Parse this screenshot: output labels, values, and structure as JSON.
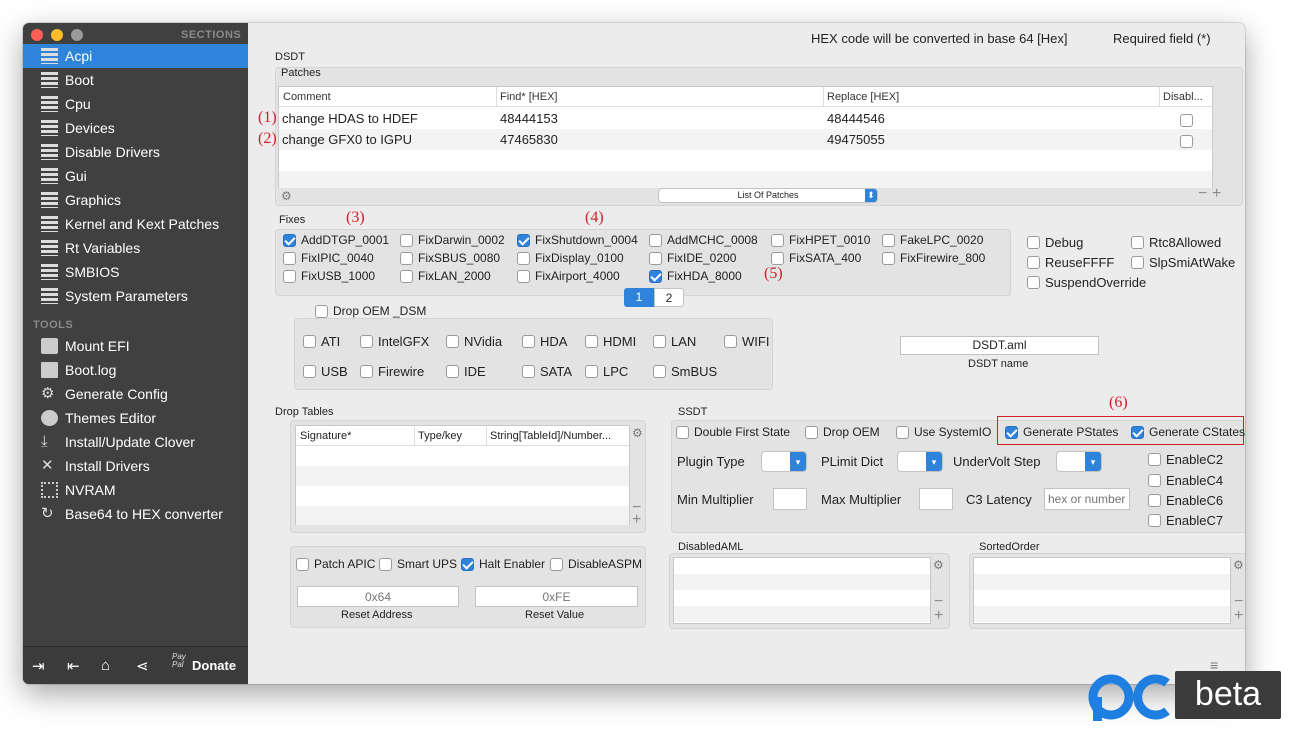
{
  "sidebar": {
    "sections_label": "SECTIONS",
    "tools_label": "TOOLS",
    "sections": [
      "Acpi",
      "Boot",
      "Cpu",
      "Devices",
      "Disable Drivers",
      "Gui",
      "Graphics",
      "Kernel and Kext Patches",
      "Rt Variables",
      "SMBIOS",
      "System Parameters"
    ],
    "tools": [
      "Mount EFI",
      "Boot.log",
      "Generate Config",
      "Themes Editor",
      "Install/Update Clover",
      "Install Drivers",
      "NVRAM",
      "Base64 to HEX converter"
    ],
    "tool_icons": [
      "disk-icon",
      "log-icon",
      "gear-icon",
      "palette-icon",
      "download-icon",
      "tools-icon",
      "chip-icon",
      "refresh-icon"
    ],
    "donate_label": "Donate",
    "paypal_label": "Pay Pal",
    "accent": "#2f83d9"
  },
  "header": {
    "hex_note": "HEX code will be converted in base 64 [Hex]",
    "required_note": "Required field (*)"
  },
  "dsdt": {
    "label": "DSDT",
    "patches_label": "Patches",
    "columns": [
      "Comment",
      "Find* [HEX]",
      "Replace [HEX]",
      "Disabl..."
    ],
    "rows": [
      {
        "marker": "(1)",
        "comment": "change HDAS to HDEF",
        "find": "48444153",
        "replace": "48444546"
      },
      {
        "marker": "(2)",
        "comment": "change GFX0 to IGPU",
        "find": "47465830",
        "replace": "49475055"
      }
    ],
    "list_select": "List Of Patches",
    "fixes_label": "Fixes",
    "fixes_markers": {
      "m3": "(3)",
      "m4": "(4)",
      "m5": "(5)"
    },
    "fixes": [
      [
        "AddDTGP_0001",
        "FixDarwin_0002",
        "FixShutdown_0004",
        "AddMCHC_0008",
        "FixHPET_0010",
        "FakeLPC_0020"
      ],
      [
        "FixIPIC_0040",
        "FixSBUS_0080",
        "FixDisplay_0100",
        "FixIDE_0200",
        "FixSATA_400",
        "FixFirewire_800"
      ],
      [
        "FixUSB_1000",
        "FixLAN_2000",
        "FixAirport_4000",
        "FixHDA_8000"
      ]
    ],
    "page1": "1",
    "page2": "2",
    "right_checks": [
      "Debug",
      "Rtc8Allowed",
      "ReuseFFFF",
      "SlpSmiAtWake",
      "SuspendOverride"
    ],
    "drop_oem_dsm": "Drop OEM _DSM",
    "dsm_devices": [
      [
        "ATI",
        "IntelGFX",
        "NVidia",
        "HDA",
        "HDMI",
        "LAN",
        "WIFI"
      ],
      [
        "USB",
        "Firewire",
        "IDE",
        "SATA",
        "LPC",
        "SmBUS"
      ]
    ],
    "dsdt_name_value": "DSDT.aml",
    "dsdt_name_label": "DSDT name"
  },
  "drop_tables": {
    "label": "Drop Tables",
    "columns": [
      "Signature*",
      "Type/key",
      "String[TableId]/Number..."
    ]
  },
  "ssdt": {
    "label": "SSDT",
    "marker6": "(6)",
    "checks": [
      "Double First State",
      "Drop OEM",
      "Use SystemIO",
      "Generate PStates",
      "Generate CStates"
    ],
    "plugin_type": "Plugin Type",
    "plimit_dict": "PLimit Dict",
    "undervolt_step": "UnderVolt Step",
    "min_multiplier": "Min Multiplier",
    "max_multiplier": "Max Multiplier",
    "c3_latency": "C3 Latency",
    "c3_placeholder": "hex or number",
    "enable": [
      "EnableC2",
      "EnableC4",
      "EnableC6",
      "EnableC7"
    ]
  },
  "misc": {
    "checks": [
      "Patch APIC",
      "Smart UPS",
      "Halt Enabler",
      "DisableASPM"
    ],
    "reset_address_placeholder": "0x64",
    "reset_address_label": "Reset Address",
    "reset_value_placeholder": "0xFE",
    "reset_value_label": "Reset Value"
  },
  "disabled_aml": {
    "label": "DisabledAML"
  },
  "sorted_order": {
    "label": "SortedOrder"
  },
  "watermark": {
    "logo": "pc",
    "text": "beta"
  }
}
